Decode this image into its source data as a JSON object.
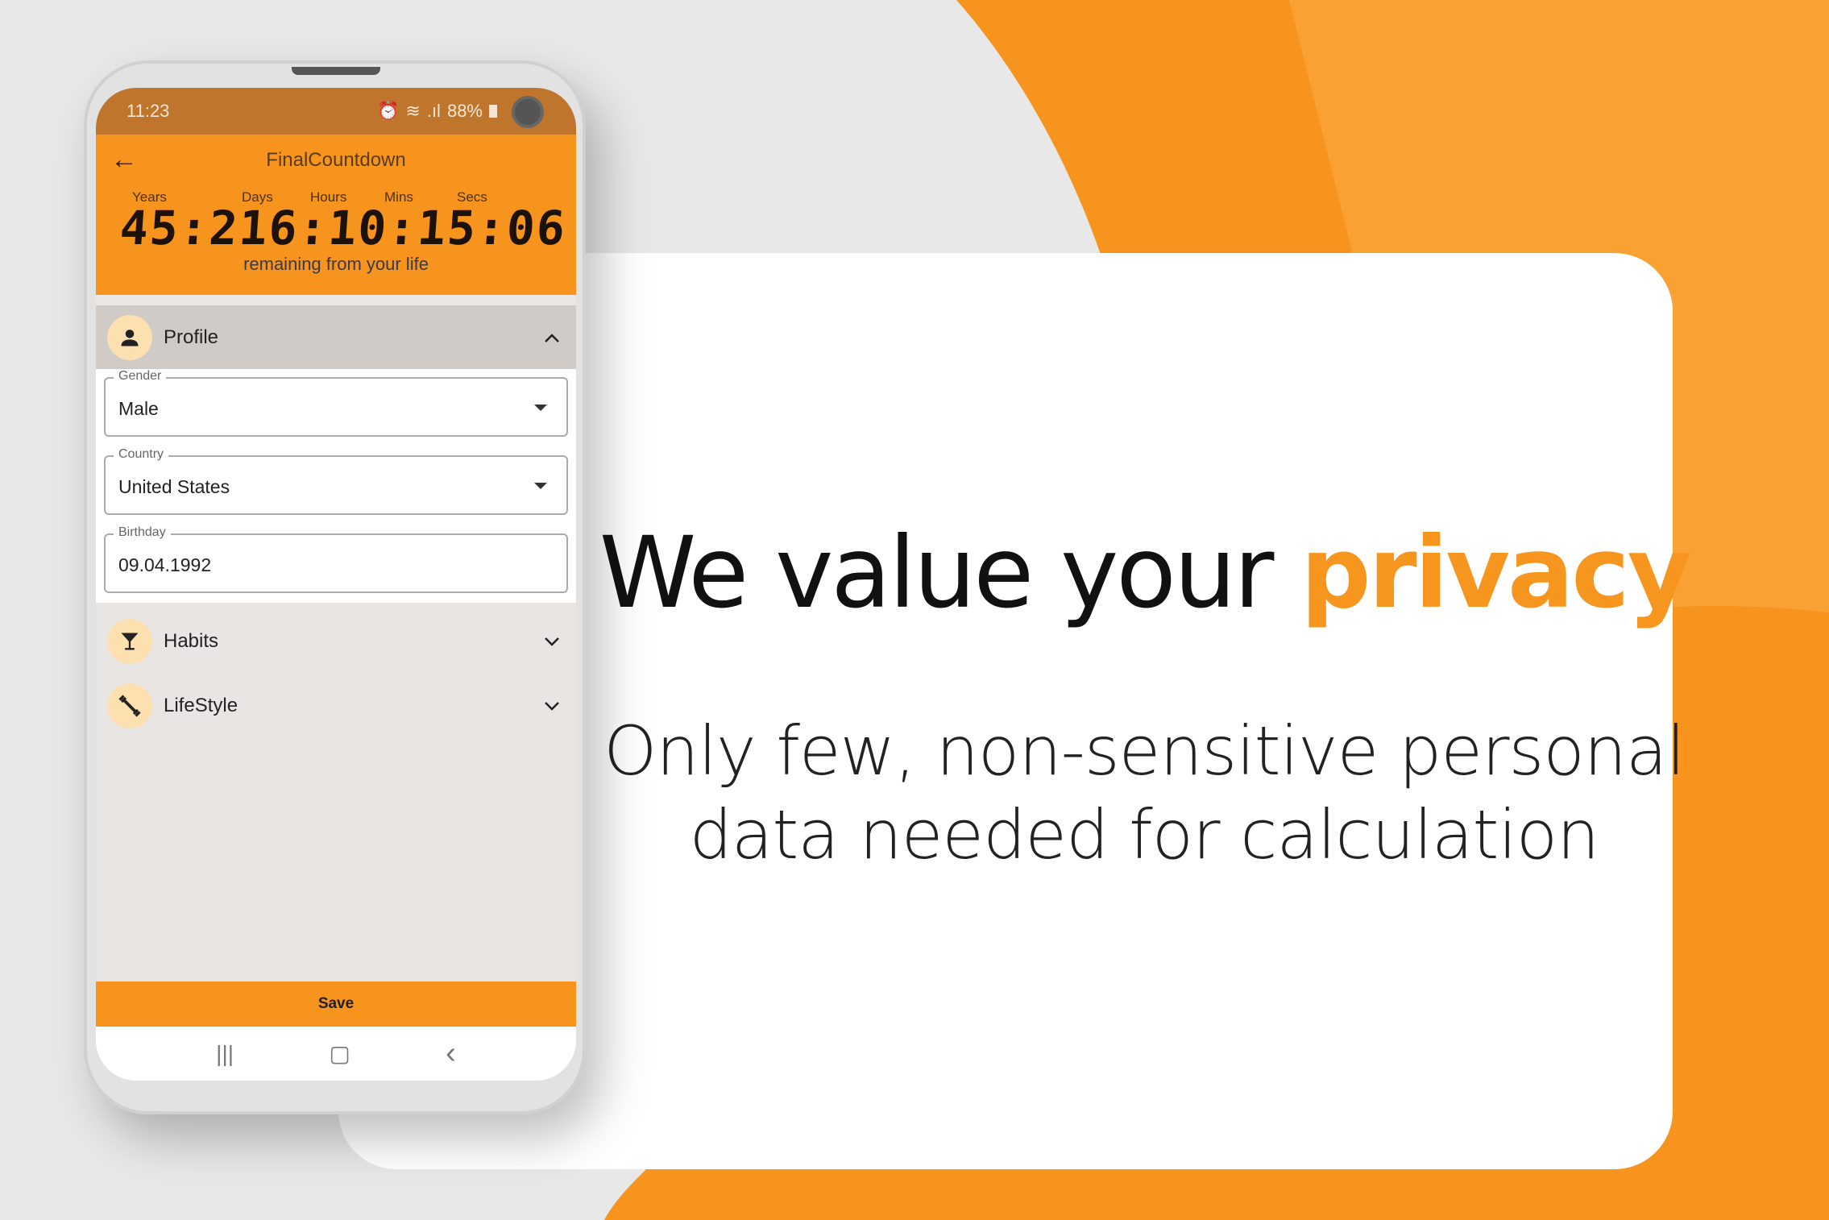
{
  "colors": {
    "accent": "#f7941d",
    "status_bar": "#bf752b",
    "background": "#e8e8e8"
  },
  "phone": {
    "status": {
      "time": "11:23",
      "battery": "88%",
      "icons": [
        "alarm-icon",
        "wifi-icon",
        "signal-icon",
        "battery-icon"
      ]
    },
    "appbar": {
      "title": "FinalCountdown",
      "back_icon": "arrow-left-icon",
      "units": {
        "years": "Years",
        "days": "Days",
        "hours": "Hours",
        "mins": "Mins",
        "secs": "Secs"
      },
      "countdown": "45:216:10:15:06",
      "subtitle": "remaining from your life"
    },
    "sections": [
      {
        "label": "Profile",
        "icon": "person-icon",
        "expanded": true
      },
      {
        "label": "Habits",
        "icon": "cocktail-icon",
        "expanded": false
      },
      {
        "label": "LifeStyle",
        "icon": "dumbbell-icon",
        "expanded": false
      }
    ],
    "fields": [
      {
        "label": "Gender",
        "value": "Male"
      },
      {
        "label": "Country",
        "value": "United States"
      },
      {
        "label": "Birthday",
        "value": "09.04.1992"
      }
    ],
    "save_label": "Save",
    "nav": {
      "recents": "|||",
      "home": "▢",
      "back": "‹"
    }
  },
  "promo": {
    "headline_main": "We value your ",
    "headline_accent": "privacy",
    "sub_line1": "Only few, non-sensitive personal",
    "sub_line2": "data needed for calculation"
  }
}
